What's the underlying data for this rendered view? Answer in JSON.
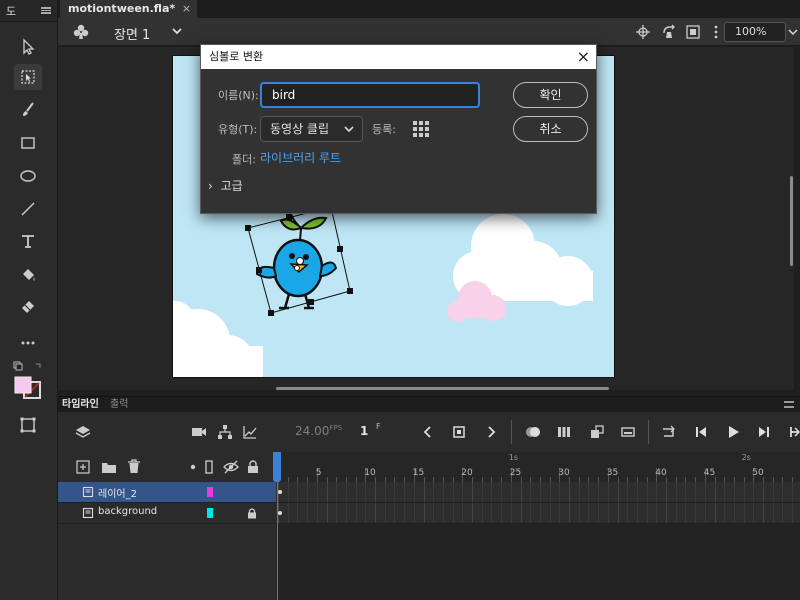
{
  "tools_panel": {
    "title": "도"
  },
  "document": {
    "tab_title": "motiontween.fla*",
    "tab_close": "×"
  },
  "scene_bar": {
    "scene_label": "장면 1",
    "zoom": "100%"
  },
  "dialog": {
    "title": "심볼로 변환",
    "close": "×",
    "name_label": "이름(N):",
    "name_value": "bird",
    "type_label": "유형(T):",
    "type_value": "동영상 클립",
    "registration_label": "등록:",
    "folder_label": "폴더:",
    "folder_link": "라이브러리 루트",
    "advanced_label": "고급",
    "ok_label": "확인",
    "cancel_label": "취소"
  },
  "timeline": {
    "tab_label": "타임라인",
    "output_tab": "출력",
    "fps": "24.00",
    "fps_unit": "FPS",
    "current_frame": "1",
    "frame_unit": "F",
    "ruler_numbers": [
      "5",
      "10",
      "15",
      "20",
      "25",
      "30",
      "35",
      "40",
      "45",
      "50"
    ],
    "ruler_seconds": [
      "1s",
      "2s"
    ],
    "layers": [
      {
        "name": "레이어_2",
        "color": "#e040e0",
        "selected": true
      },
      {
        "name": "background",
        "color": "#00e5e5",
        "locked": true
      }
    ]
  },
  "colors": {
    "accent": "#3b82d6",
    "stage_sky": "#bfe6f5",
    "fill_swatch": "#f7c8f0",
    "bird_blue": "#1aa7e8"
  }
}
